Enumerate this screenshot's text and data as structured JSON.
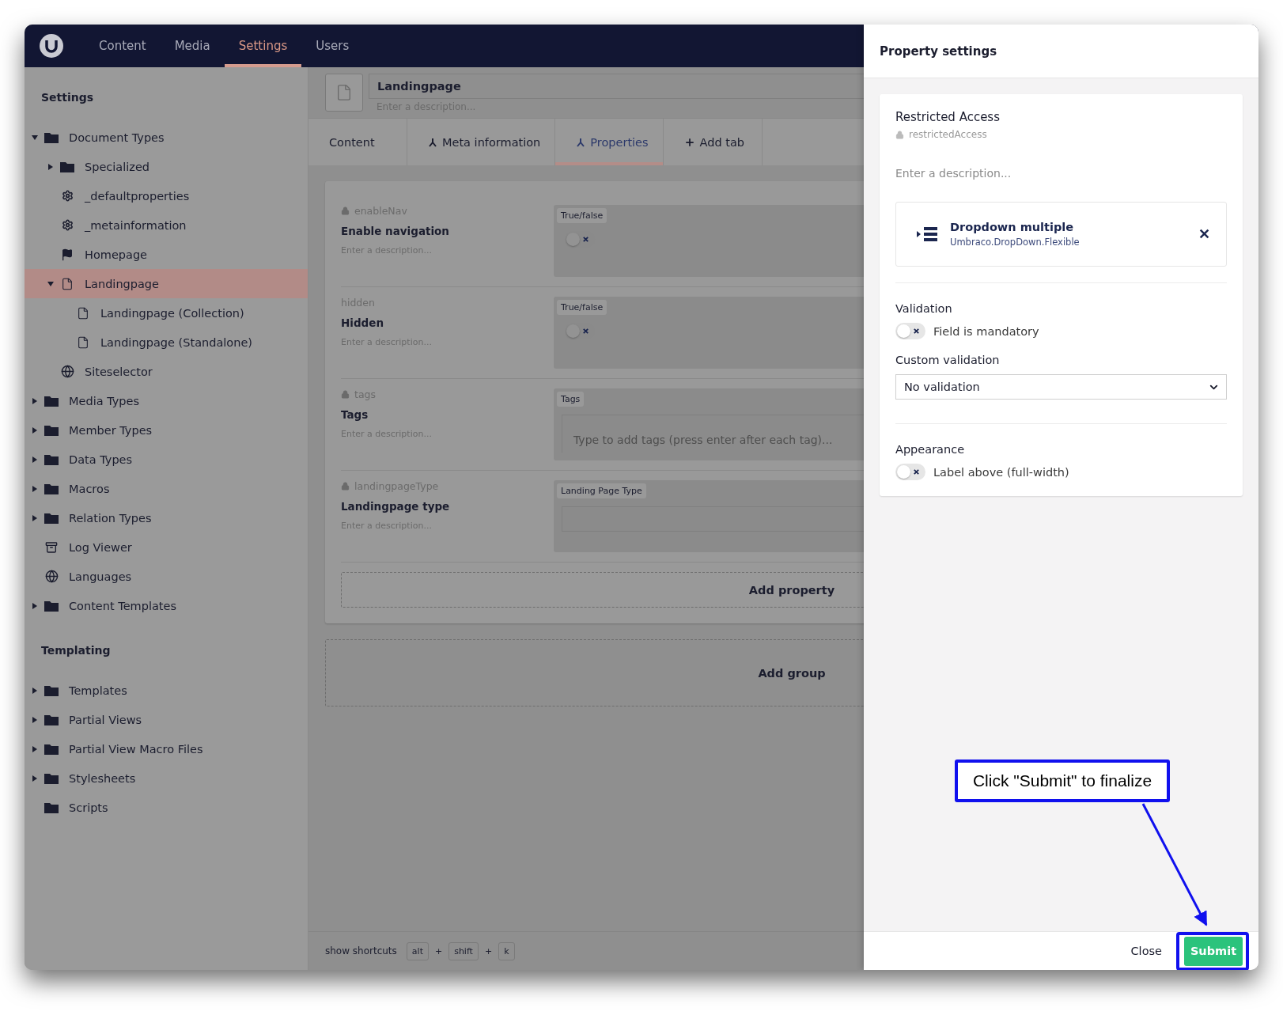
{
  "topbar": {
    "nav": [
      {
        "label": "Content",
        "selected": false
      },
      {
        "label": "Media",
        "selected": false
      },
      {
        "label": "Settings",
        "selected": true
      },
      {
        "label": "Users",
        "selected": false
      }
    ]
  },
  "sidebar": {
    "sections": [
      {
        "title": "Settings",
        "items": [
          {
            "label": "Document Types",
            "kind": "folder",
            "expanded": true,
            "selected": false,
            "children": [
              {
                "label": "Specialized",
                "kind": "folder",
                "expanded": false,
                "selected": false
              },
              {
                "label": "_defaultproperties",
                "kind": "settings",
                "selected": false
              },
              {
                "label": "_metainformation",
                "kind": "settings",
                "selected": false
              },
              {
                "label": "Homepage",
                "kind": "flag",
                "selected": false
              },
              {
                "label": "Landingpage",
                "kind": "page",
                "expanded": true,
                "selected": true,
                "children": [
                  {
                    "label": "Landingpage (Collection)",
                    "kind": "page",
                    "selected": false
                  },
                  {
                    "label": "Landingpage (Standalone)",
                    "kind": "page",
                    "selected": false
                  }
                ]
              },
              {
                "label": "Siteselector",
                "kind": "globe",
                "selected": false
              }
            ]
          },
          {
            "label": "Media Types",
            "kind": "folder",
            "expanded": false,
            "selected": false
          },
          {
            "label": "Member Types",
            "kind": "folder",
            "expanded": false,
            "selected": false
          },
          {
            "label": "Data Types",
            "kind": "folder",
            "expanded": false,
            "selected": false
          },
          {
            "label": "Macros",
            "kind": "folder",
            "expanded": false,
            "selected": false
          },
          {
            "label": "Relation Types",
            "kind": "folder",
            "expanded": false,
            "selected": false
          },
          {
            "label": "Log Viewer",
            "kind": "archive",
            "selected": false
          },
          {
            "label": "Languages",
            "kind": "globe",
            "selected": false
          },
          {
            "label": "Content Templates",
            "kind": "folder",
            "expanded": false,
            "selected": false
          }
        ]
      },
      {
        "title": "Templating",
        "items": [
          {
            "label": "Templates",
            "kind": "folder",
            "expanded": false,
            "selected": false
          },
          {
            "label": "Partial Views",
            "kind": "folder",
            "expanded": false,
            "selected": false
          },
          {
            "label": "Partial View Macro Files",
            "kind": "folder",
            "expanded": false,
            "selected": false
          },
          {
            "label": "Stylesheets",
            "kind": "folder",
            "expanded": false,
            "selected": false
          },
          {
            "label": "Scripts",
            "kind": "folder",
            "selected": false
          }
        ]
      }
    ]
  },
  "editor": {
    "name": "Landingpage",
    "description_placeholder": "Enter a description...",
    "tabs": [
      {
        "label": "Content",
        "kind": "plain",
        "selected": false
      },
      {
        "label": "Meta information",
        "kind": "group",
        "selected": false
      },
      {
        "label": "Properties",
        "kind": "group",
        "selected": true
      },
      {
        "label": "Add tab",
        "kind": "add",
        "selected": false
      }
    ],
    "properties": [
      {
        "alias": "enableNav",
        "locked": true,
        "name": "Enable navigation",
        "description_placeholder": "Enter a description...",
        "editor_label": "True/false",
        "kind": "toggle",
        "on": false
      },
      {
        "alias": "hidden",
        "locked": false,
        "name": "Hidden",
        "description_placeholder": "Enter a description...",
        "editor_label": "True/false",
        "kind": "toggle",
        "on": false
      },
      {
        "alias": "tags",
        "locked": true,
        "name": "Tags",
        "description_placeholder": "Enter a description...",
        "editor_label": "Tags",
        "kind": "tags",
        "placeholder": "Type to add tags (press enter after each tag)..."
      },
      {
        "alias": "landingpageType",
        "locked": true,
        "name": "Landingpage type",
        "description_placeholder": "Enter a description...",
        "editor_label": "Landing Page Type",
        "kind": "dropdown"
      }
    ],
    "add_property": "Add property",
    "add_group": "Add group"
  },
  "shortcuts": {
    "label": "show shortcuts",
    "keys": [
      {
        "kind": "key",
        "text": "alt"
      },
      {
        "kind": "plus",
        "text": "+"
      },
      {
        "kind": "key",
        "text": "shift"
      },
      {
        "kind": "plus",
        "text": "+"
      },
      {
        "kind": "key",
        "text": "k"
      }
    ]
  },
  "panel": {
    "title": "Property settings",
    "name": "Restricted Access",
    "alias": "restrictedAccess",
    "locked": true,
    "description_placeholder": "Enter a description...",
    "editor": {
      "name": "Dropdown multiple",
      "alias": "Umbraco.DropDown.Flexible",
      "remove": "✕"
    },
    "validation": {
      "title": "Validation",
      "mandatory": {
        "label": "Field is mandatory",
        "on": false
      },
      "custom_label": "Custom validation",
      "custom_value": "No validation"
    },
    "appearance": {
      "title": "Appearance",
      "label_above": {
        "label": "Label above (full-width)",
        "on": false
      }
    },
    "close": "Close",
    "submit": "Submit"
  },
  "annotation": {
    "text": "Click \"Submit\" to finalize"
  }
}
